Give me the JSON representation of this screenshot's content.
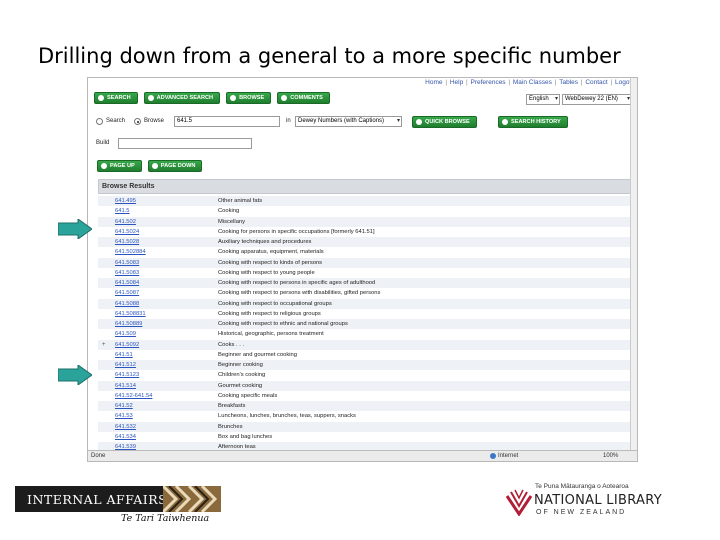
{
  "slide": {
    "title": "Drilling down from a general to a more specific number"
  },
  "nav_links": [
    "Home",
    "Help",
    "Preferences",
    "Main Classes",
    "Tables",
    "Contact",
    "Logoff"
  ],
  "toolbar": {
    "search": "SEARCH",
    "advanced_search": "ADVANCED SEARCH",
    "browse": "BROWSE",
    "comments": "COMMENTS"
  },
  "language_select": "English",
  "version_select": "WebDewey 22 (EN)",
  "browse_bar": {
    "search_label": "Search",
    "browse_label": "Browse",
    "browse_value": "641.5",
    "in_label": "in",
    "scope_select": "Dewey Numbers (with Captions)",
    "quick_browse": "QUICK BROWSE",
    "search_history": "SEARCH HISTORY"
  },
  "build": {
    "label": "Build",
    "value": ""
  },
  "paging": {
    "page_up": "PAGE UP",
    "page_down": "PAGE DOWN"
  },
  "results": {
    "heading": "Browse Results",
    "rows": [
      {
        "num": "641.495",
        "cap": "Other animal fats"
      },
      {
        "num": "641.5",
        "cap": "Cooking"
      },
      {
        "num": "641.502",
        "cap": "Miscellany"
      },
      {
        "num": "641.5024",
        "cap": "Cooking for persons in specific occupations [formerly 641.51]"
      },
      {
        "num": "641.5028",
        "cap": "Auxiliary techniques and procedures"
      },
      {
        "num": "641.502884",
        "cap": "Cooking apparatus, equipment, materials"
      },
      {
        "num": "641.5083",
        "cap": "Cooking with respect to kinds of persons"
      },
      {
        "num": "641.5083",
        "cap": "Cooking with respect to young people"
      },
      {
        "num": "641.5084",
        "cap": "Cooking with respect to persons in specific ages of adulthood"
      },
      {
        "num": "641.5087",
        "cap": "Cooking with respect to persons with disabilities, gifted persons"
      },
      {
        "num": "641.5088",
        "cap": "Cooking with respect to occupational groups"
      },
      {
        "num": "641.508831",
        "cap": "Cooking with respect to religious groups"
      },
      {
        "num": "641.50889",
        "cap": "Cooking with respect to ethnic and national groups"
      },
      {
        "num": "641.509",
        "cap": "Historical, geographic, persons treatment"
      },
      {
        "num": "641.5092",
        "cap": "Cooks . . .",
        "plus": "+"
      },
      {
        "num": "641.51",
        "cap": "Beginner and gourmet cooking"
      },
      {
        "num": "641.512",
        "cap": "Beginner cooking"
      },
      {
        "num": "641.5123",
        "cap": "Children's cooking"
      },
      {
        "num": "641.514",
        "cap": "Gourmet cooking"
      },
      {
        "num": "641.52-641.54",
        "cap": "Cooking specific meals"
      },
      {
        "num": "641.52",
        "cap": "Breakfasts"
      },
      {
        "num": "641.53",
        "cap": "Luncheons, lunches, brunches, teas, suppers, snacks"
      },
      {
        "num": "641.532",
        "cap": "Brunches"
      },
      {
        "num": "641.534",
        "cap": "Box and bag lunches"
      },
      {
        "num": "641.539",
        "cap": "Afternoon teas"
      }
    ]
  },
  "status_bar": {
    "done": "Done",
    "zone": "Internet",
    "zoom": "100%"
  },
  "logos": {
    "internal_affairs": "INTERNAL AFFAIRS",
    "internal_affairs_sub": "Te Tari Taiwhenua",
    "nl_tag": "Te Puna Mātauranga o Aotearoa",
    "nl_name": "NATIONAL LIBRARY",
    "nl_sub": "OF NEW ZEALAND"
  },
  "colors": {
    "button_green": "#2a9138",
    "link_blue": "#2a55c0",
    "arrow_teal": "#2aa39a"
  }
}
